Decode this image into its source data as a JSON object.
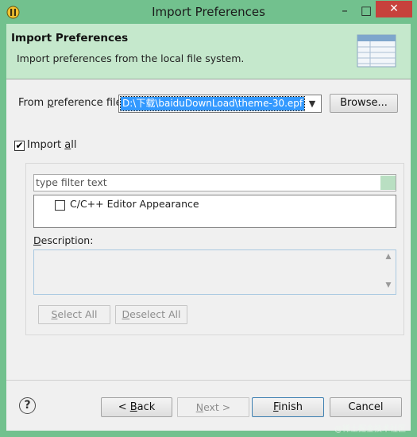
{
  "window": {
    "title": "Import Preferences",
    "minimize_glyph": "–",
    "maximize_glyph": "□",
    "close_glyph": "✕"
  },
  "banner": {
    "title": "Import Preferences",
    "description": "Import preferences from the local file system.",
    "graphic_icon": "preferences-table-icon"
  },
  "from_file": {
    "label_pre": "From ",
    "label_mnemonic": "p",
    "label_post": "reference file:",
    "value": "D:\\下载\\baiduDownLoad\\theme-30.epf",
    "dropdown_glyph": "▼",
    "browse_label": "Browse..."
  },
  "import_all": {
    "checked": true,
    "check_glyph": "✔",
    "label_pre": "Import ",
    "label_mnemonic": "a",
    "label_post": "ll"
  },
  "filter": {
    "placeholder": "type filter text"
  },
  "preference_items": [
    {
      "label": "C/C++ Editor Appearance",
      "checked": false
    }
  ],
  "description": {
    "label_pre": "",
    "label_mnemonic": "D",
    "label_post": "escription:"
  },
  "buttons": {
    "select_all_mnemonic": "S",
    "select_all_rest": "elect All",
    "deselect_all_mnemonic": "D",
    "deselect_all_rest": "eselect All",
    "back_pre": "< ",
    "back_mnemonic": "B",
    "back_rest": "ack",
    "next_pre": "",
    "next_mnemonic": "N",
    "next_rest": "ext >",
    "finish_mnemonic": "F",
    "finish_rest": "inish",
    "cancel_label": "Cancel",
    "help_glyph": "?"
  },
  "watermark": "@稀土掘金技术社区",
  "colors": {
    "title_bar": "#72c18e",
    "banner": "#c5e8cc",
    "close_button": "#c7413c",
    "selection": "#3399ff"
  }
}
